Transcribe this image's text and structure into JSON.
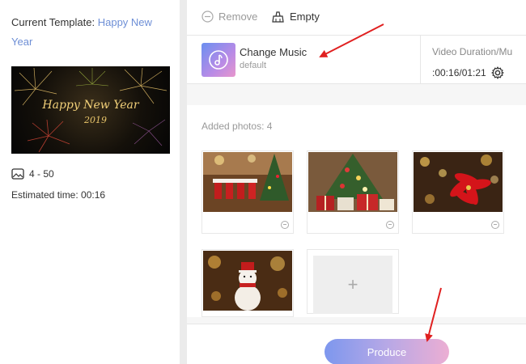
{
  "left": {
    "current_template_label": "Current Template:",
    "template_name": "Happy New Year",
    "thumbnail_text": "Happy New Year",
    "thumbnail_year": "2019",
    "photo_range": "4 - 50",
    "estimated_time": "Estimated time: 00:16"
  },
  "toolbar": {
    "remove_label": "Remove",
    "empty_label": "Empty"
  },
  "music": {
    "title": "Change Music",
    "subtitle": "default",
    "duration_label": "Video Duration/Mu",
    "duration_value": ":00:16/01:21"
  },
  "photos": {
    "added_label": "Added photos: 4",
    "items": [
      {
        "name": "christmas-stockings"
      },
      {
        "name": "christmas-tree-gifts"
      },
      {
        "name": "poinsettia"
      },
      {
        "name": "snowman"
      }
    ],
    "add_symbol": "+"
  },
  "footer": {
    "produce_label": "Produce"
  },
  "colors": {
    "accent_blue": "#6e8fd6",
    "annotation_red": "#e02020"
  }
}
